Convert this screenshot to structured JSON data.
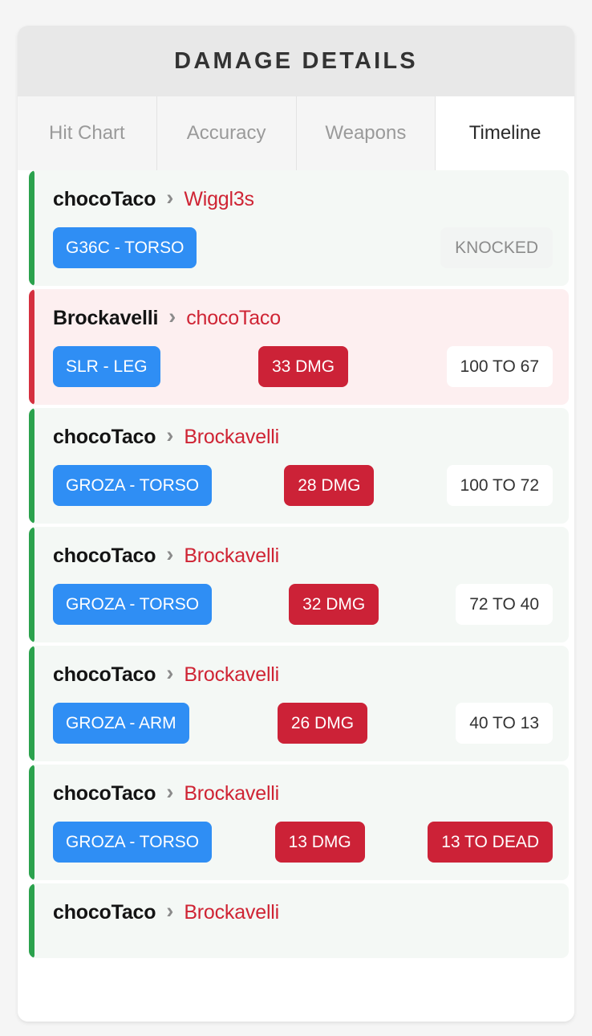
{
  "header": {
    "title": "DAMAGE DETAILS"
  },
  "tabs": [
    {
      "label": "Hit Chart",
      "active": false
    },
    {
      "label": "Accuracy",
      "active": false
    },
    {
      "label": "Weapons",
      "active": false
    },
    {
      "label": "Timeline",
      "active": true
    }
  ],
  "colors": {
    "accent_outgoing": "#2ba24d",
    "accent_incoming": "#d5303f",
    "row_outgoing_bg": "#f4f8f5",
    "row_incoming_bg": "#fdeff0",
    "weapon_badge": "#2f8ef4",
    "damage_badge": "#cc2237",
    "victim_text": "#cf2434",
    "status_badge_bg": "#f2f4f3",
    "header_bg": "#e8e8e8"
  },
  "separator": "›",
  "timeline": {
    "events": [
      {
        "direction": "outgoing",
        "attacker": "chocoTaco",
        "victim": "Wiggl3s",
        "weapon": "G36C - TORSO",
        "damage": null,
        "health": null,
        "status": "KNOCKED"
      },
      {
        "direction": "incoming",
        "attacker": "Brockavelli",
        "victim": "chocoTaco",
        "weapon": "SLR - LEG",
        "damage": "33 DMG",
        "health": "100 TO 67",
        "status": null
      },
      {
        "direction": "outgoing",
        "attacker": "chocoTaco",
        "victim": "Brockavelli",
        "weapon": "GROZA - TORSO",
        "damage": "28 DMG",
        "health": "100 TO 72",
        "status": null
      },
      {
        "direction": "outgoing",
        "attacker": "chocoTaco",
        "victim": "Brockavelli",
        "weapon": "GROZA - TORSO",
        "damage": "32 DMG",
        "health": "72 TO 40",
        "status": null
      },
      {
        "direction": "outgoing",
        "attacker": "chocoTaco",
        "victim": "Brockavelli",
        "weapon": "GROZA - ARM",
        "damage": "26 DMG",
        "health": "40 TO 13",
        "status": null
      },
      {
        "direction": "outgoing",
        "attacker": "chocoTaco",
        "victim": "Brockavelli",
        "weapon": "GROZA - TORSO",
        "damage": "13 DMG",
        "health": "13 TO DEAD",
        "health_fatal": true,
        "status": null
      },
      {
        "direction": "outgoing",
        "attacker": "chocoTaco",
        "victim": "Brockavelli",
        "weapon": null,
        "damage": null,
        "health": null,
        "status": null
      }
    ]
  }
}
